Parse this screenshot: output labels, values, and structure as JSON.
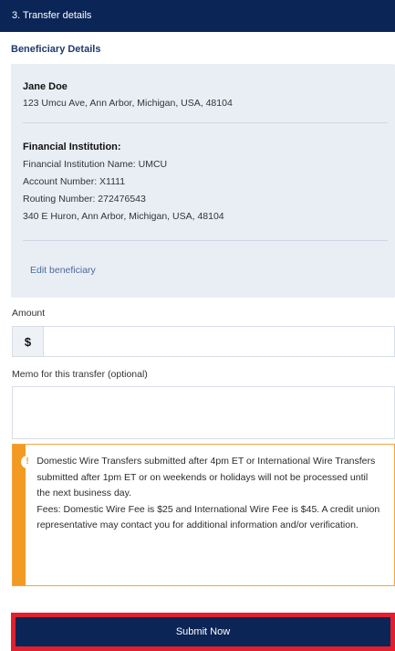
{
  "header": {
    "title": "3. Transfer details"
  },
  "beneficiary": {
    "section_label": "Beneficiary Details",
    "name": "Jane Doe",
    "address": "123 Umcu Ave, Ann Arbor, Michigan, USA, 48104",
    "financial_institution": {
      "title": "Financial Institution:",
      "name_line": "Financial Institution Name: UMCU",
      "account_line": "Account Number: X1111",
      "routing_line": "Routing Number: 272476543",
      "address_line": "340 E Huron, Ann Arbor, Michigan, USA, 48104"
    },
    "edit_link": "Edit beneficiary"
  },
  "amount": {
    "label": "Amount",
    "prefix": "$",
    "value": ""
  },
  "memo": {
    "label": "Memo for this transfer (optional)",
    "value": ""
  },
  "notice": {
    "icon": "info-icon",
    "text": "Domestic Wire Transfers submitted after 4pm ET or International Wire Transfers submitted after 1pm ET or on weekends or holidays will not be processed until the next business day.",
    "fees": "Fees: Domestic Wire Fee is $25 and International Wire Fee is $45. A credit union representative may contact you for additional information and/or verification."
  },
  "actions": {
    "submit_label": "Submit Now"
  },
  "colors": {
    "header_bg": "#0b2556",
    "card_bg": "#e9eef5",
    "notice_accent": "#f39a22",
    "highlight": "#e0202f"
  }
}
